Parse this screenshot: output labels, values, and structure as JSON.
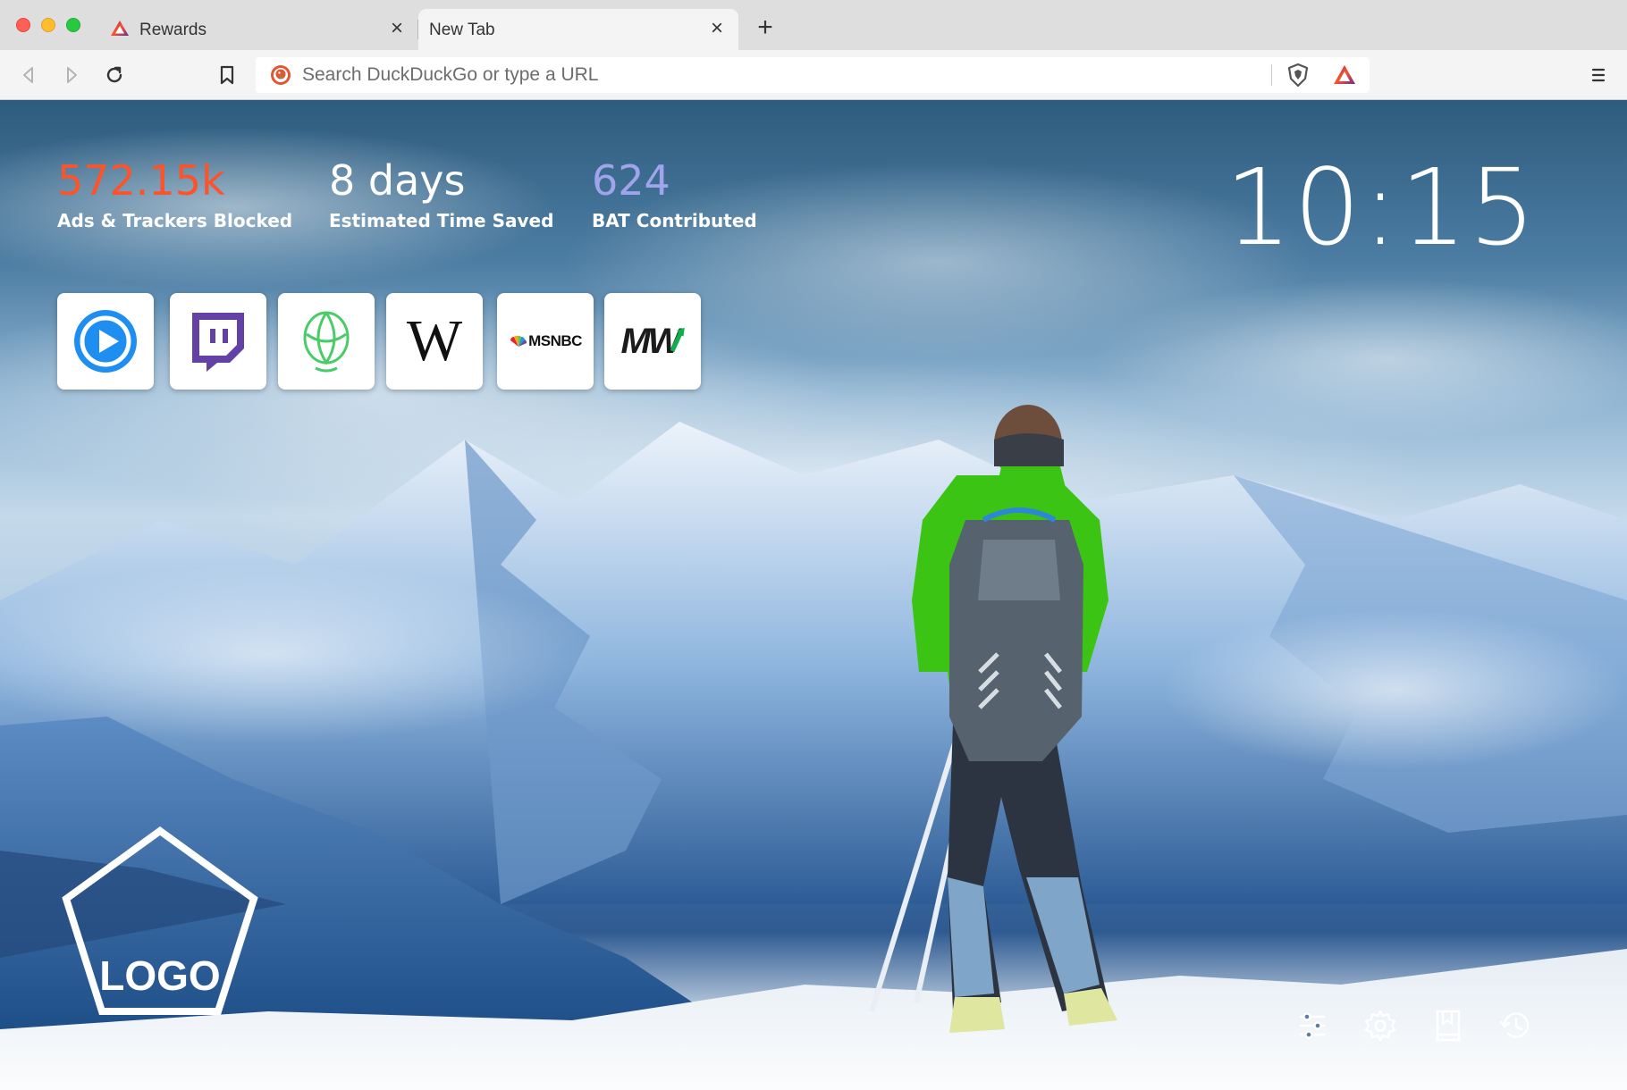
{
  "window": {
    "traffic_lights": {
      "close": "#fe5f57",
      "minimize": "#febc2e",
      "zoom": "#28c840"
    }
  },
  "tabs": [
    {
      "title": "Rewards",
      "active": false,
      "favicon": "brave-rewards-triangle-icon"
    },
    {
      "title": "New Tab",
      "active": true
    }
  ],
  "toolbar": {
    "back_icon": "back-arrow-icon",
    "forward_icon": "forward-arrow-icon",
    "reload_icon": "reload-icon",
    "bookmark_icon": "bookmark-icon",
    "omnibox": {
      "placeholder": "Search DuckDuckGo or type a URL",
      "value": "",
      "search_engine_icon": "duckduckgo-icon"
    },
    "shields_icon": "brave-shield-icon",
    "rewards_icon": "brave-rewards-triangle-icon",
    "menu_icon": "hamburger-menu-icon"
  },
  "stats": {
    "ads": {
      "value": "572.15k",
      "label": "Ads & Trackers Blocked",
      "color": "#fb542b"
    },
    "time": {
      "value": "8 days",
      "label": "Estimated Time Saved",
      "color": "#ffffff"
    },
    "bat": {
      "value": "624",
      "label": "BAT Contributed",
      "color": "#a0a5eb"
    }
  },
  "clock": {
    "time": "10:15"
  },
  "top_sites": [
    {
      "name": "play-site",
      "icon": "blue-play-icon"
    },
    {
      "name": "twitch",
      "icon": "twitch-icon"
    },
    {
      "name": "uphold",
      "icon": "uphold-icon"
    },
    {
      "name": "wikipedia",
      "icon": "wikipedia-icon",
      "text": "W"
    },
    {
      "name": "msnbc",
      "icon": "msnbc-icon",
      "text": "MSNBC"
    },
    {
      "name": "marketwatch",
      "icon": "marketwatch-icon",
      "text": "MW"
    }
  ],
  "logo": {
    "text": "LOGO"
  },
  "widgets": [
    {
      "name": "customize-button",
      "icon": "sliders-icon"
    },
    {
      "name": "settings-button",
      "icon": "gear-icon"
    },
    {
      "name": "bookmarks-button",
      "icon": "bookmarks-icon"
    },
    {
      "name": "history-button",
      "icon": "history-icon"
    }
  ]
}
